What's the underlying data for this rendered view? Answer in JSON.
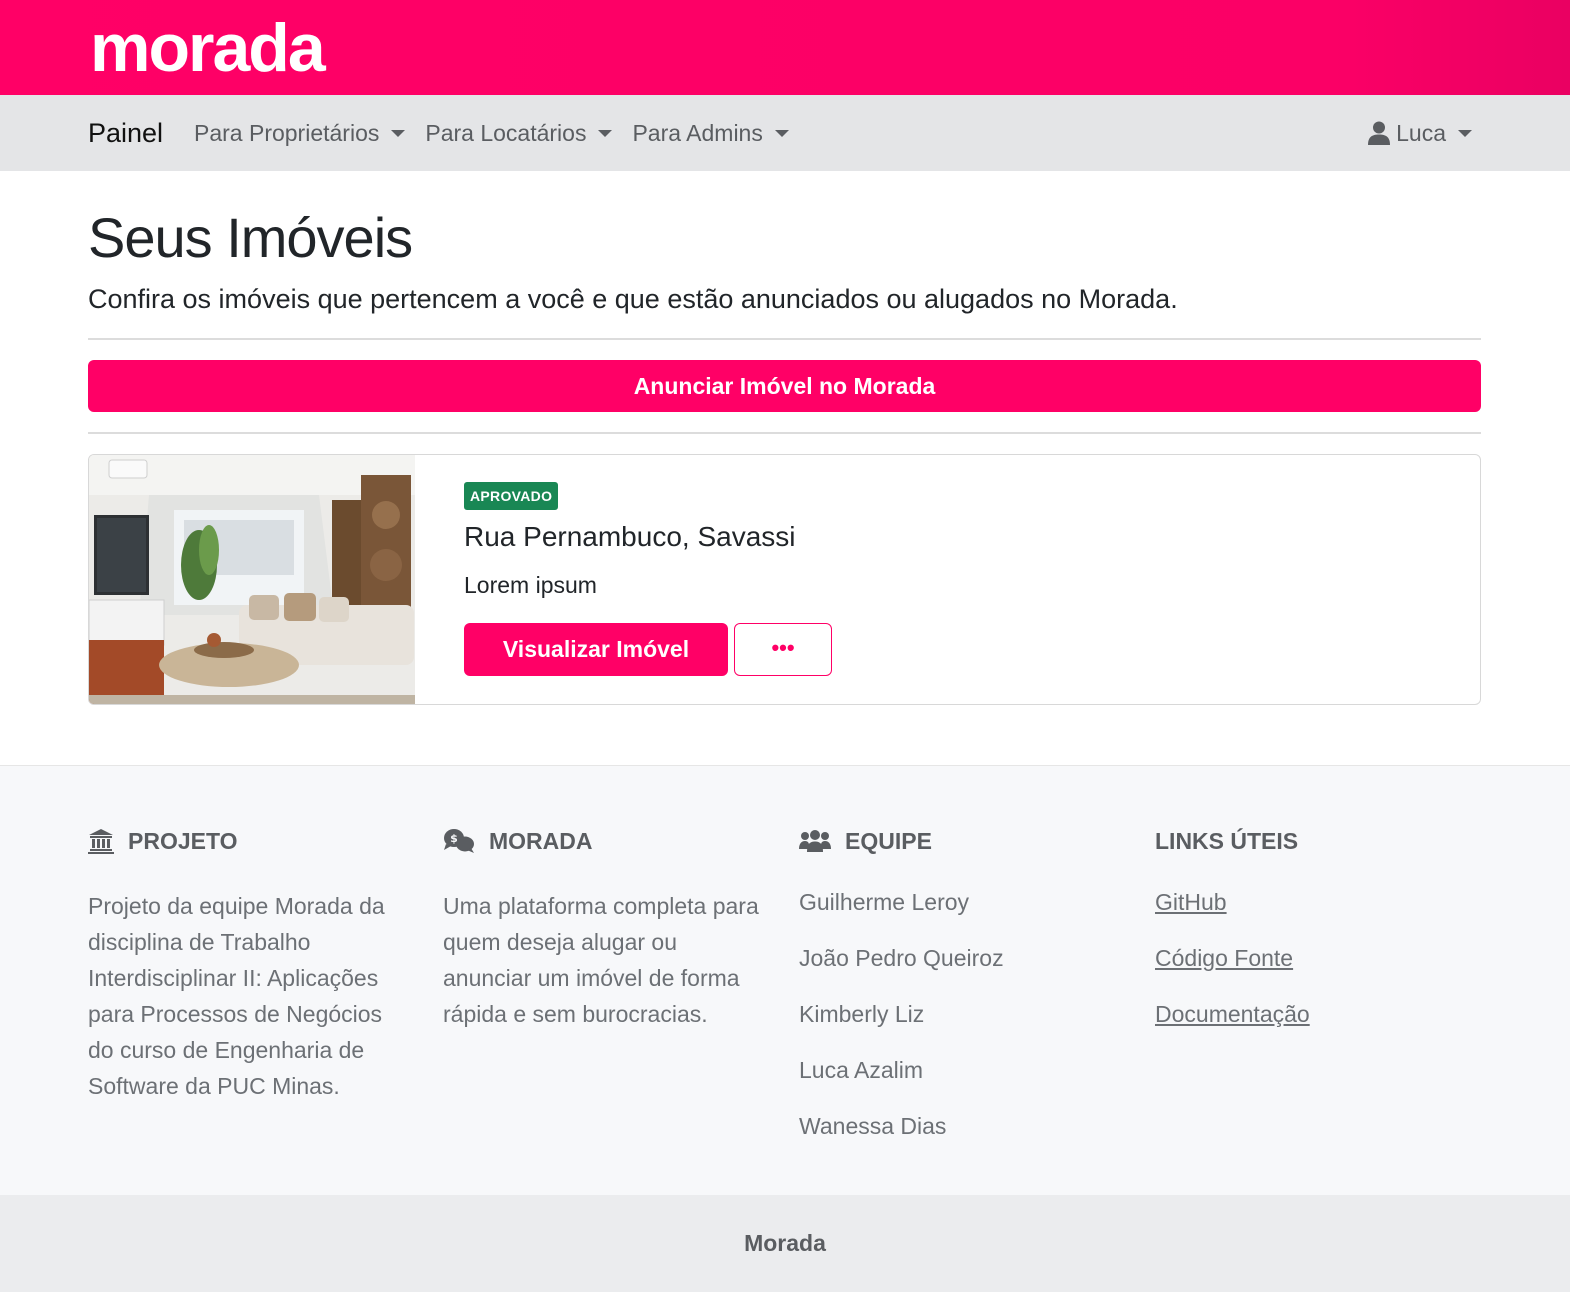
{
  "header": {
    "logo": "morada"
  },
  "navbar": {
    "brand": "Painel",
    "items": [
      {
        "label": "Para Proprietários"
      },
      {
        "label": "Para Locatários"
      },
      {
        "label": "Para Admins"
      }
    ],
    "user": {
      "name": "Luca",
      "icon": "user-icon"
    }
  },
  "main": {
    "title": "Seus Imóveis",
    "lead": "Confira os imóveis que pertencem a você e que estão anunciados ou alugados no Morada.",
    "cta_label": "Anunciar Imóvel no Morada",
    "properties": [
      {
        "status": "APROVADO",
        "status_color": "#198754",
        "title": "Rua Pernambuco, Savassi",
        "description": "Lorem ipsum",
        "view_label": "Visualizar Imóvel",
        "more_label": "•••"
      }
    ]
  },
  "footer": {
    "projeto": {
      "heading": "PROJETO",
      "icon": "landmark-icon",
      "text": "Projeto da equipe Morada da disciplina de Trabalho Interdisciplinar II: Aplicações para Processos de Negócios do curso de Engenharia de Software da PUC Minas."
    },
    "morada": {
      "heading": "MORADA",
      "icon": "comments-dollar-icon",
      "text": "Uma plataforma completa para quem deseja alugar ou anunciar um imóvel de forma rápida e sem burocracias."
    },
    "equipe": {
      "heading": "EQUIPE",
      "icon": "users-icon",
      "members": [
        "Guilherme Leroy",
        "João Pedro Queiroz",
        "Kimberly Liz",
        "Luca Azalim",
        "Wanessa Dias"
      ]
    },
    "links": {
      "heading": "LINKS ÚTEIS",
      "items": [
        "GitHub",
        "Código Fonte",
        "Documentação"
      ]
    }
  },
  "bottom": {
    "label": "Morada"
  },
  "colors": {
    "brand": "#ff0066",
    "success": "#198754",
    "navbar": "#e4e5e7",
    "footer": "#f7f8fa"
  }
}
